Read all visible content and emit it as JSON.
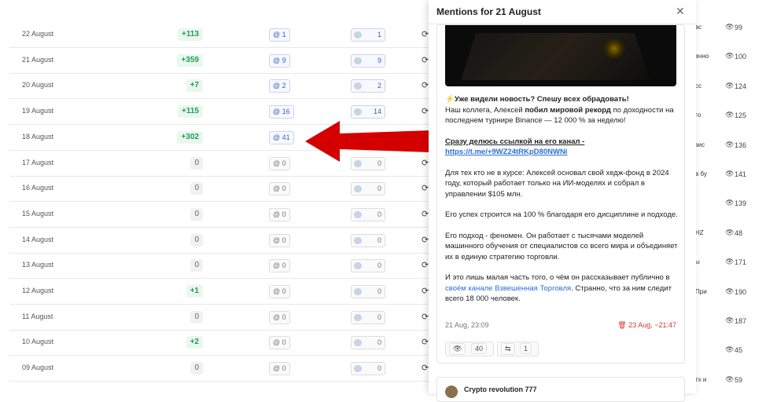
{
  "rows": [
    {
      "date": "22 August",
      "growth": "+113",
      "mentions": "1",
      "channels": "1",
      "pos": true,
      "active": true
    },
    {
      "date": "21 August",
      "growth": "+359",
      "mentions": "9",
      "channels": "9",
      "pos": true,
      "active": true
    },
    {
      "date": "20 August",
      "growth": "+7",
      "mentions": "2",
      "channels": "2",
      "pos": true,
      "active": true
    },
    {
      "date": "19 August",
      "growth": "+115",
      "mentions": "16",
      "channels": "14",
      "pos": true,
      "active": true
    },
    {
      "date": "18 August",
      "growth": "+302",
      "mentions": "41",
      "channels": "",
      "pos": true,
      "active": true
    },
    {
      "date": "17 August",
      "growth": "0",
      "mentions": "0",
      "channels": "0",
      "pos": false,
      "active": false
    },
    {
      "date": "16 August",
      "growth": "0",
      "mentions": "0",
      "channels": "0",
      "pos": false,
      "active": false
    },
    {
      "date": "15 August",
      "growth": "0",
      "mentions": "0",
      "channels": "0",
      "pos": false,
      "active": false
    },
    {
      "date": "14 August",
      "growth": "0",
      "mentions": "0",
      "channels": "0",
      "pos": false,
      "active": false
    },
    {
      "date": "13 August",
      "growth": "0",
      "mentions": "0",
      "channels": "0",
      "pos": false,
      "active": false
    },
    {
      "date": "12 August",
      "growth": "+1",
      "mentions": "0",
      "channels": "0",
      "pos": true,
      "active": false
    },
    {
      "date": "11 August",
      "growth": "0",
      "mentions": "0",
      "channels": "0",
      "pos": false,
      "active": false
    },
    {
      "date": "10 August",
      "growth": "+2",
      "mentions": "0",
      "channels": "0",
      "pos": true,
      "active": false
    },
    {
      "date": "09 August",
      "growth": "0",
      "mentions": "0",
      "channels": "0",
      "pos": false,
      "active": false
    }
  ],
  "right_rows": [
    {
      "text": "вс",
      "views": "99"
    },
    {
      "text": "ачно",
      "views": "100"
    },
    {
      "text": "сс",
      "views": "124"
    },
    {
      "text": "го",
      "views": "125"
    },
    {
      "text": "зис",
      "views": "136"
    },
    {
      "text": "в бу",
      "views": "141"
    },
    {
      "text": "",
      "views": "139"
    },
    {
      "text": "HZ",
      "views": "48"
    },
    {
      "text": "ы",
      "views": "171"
    },
    {
      "text": "При",
      "views": "190"
    },
    {
      "text": "",
      "views": "187"
    },
    {
      "text": "",
      "views": "45"
    },
    {
      "text": "тх и",
      "views": "59"
    }
  ],
  "panel": {
    "title": "Mentions for 21 August",
    "p1_bold": "⚡Уже видели новость? Спешу всех обрадовать!",
    "p1_a": "Наш коллега, Алексей ",
    "p1_b": "побил мировой рекорд",
    "p1_c": " по доходности на последнем турнире Binance — 12 000 % за неделю!",
    "p2_label": "Сразу делюсь ссылкой на его канал - ",
    "p2_link": "https://t.me/+9WZ24tRKpD80NWNi",
    "p3": "Для тех кто не в курсе: Алексей основал свой хедж-фонд в 2024 году, который работает только на ИИ-моделях и собрал в управлении $105 млн.",
    "p4": "Его успех строится на 100 % благодаря его дисциплине и подходе.",
    "p5": "Его подход - феномен. Он работает с тысячами моделей машинного обучения от специалистов со всего мира и объединяет их в единую стратегию торговли.",
    "p6_a": "И это лишь малая часть того, о чём он рассказывает публично в ",
    "p6_link": "своём канале Взвешенная Торговля",
    "p6_b": ". Странно, что за ним следит всего 18 000 человек.",
    "date": "21 Aug, 23:09",
    "deleted": "23 Aug, ~21:47",
    "views": "40",
    "reposts": "1",
    "next_channel": "Crypto revolution 777"
  },
  "colors": {
    "positive": "#1f9d55",
    "link": "#2a6fd6",
    "arrow": "#d40000",
    "deleted": "#dd3333"
  }
}
